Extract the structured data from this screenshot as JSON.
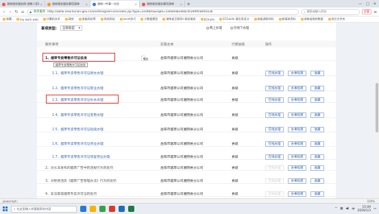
{
  "browser": {
    "tabs": [
      {
        "title": "湖南政务服务网-湖南人民政府",
        "active": false
      },
      {
        "title": "湖南政务服务事项清单",
        "active": false
      },
      {
        "title": "湖南一件事一次办",
        "active": true
      },
      {
        "title": "湖南政务服务事项清单",
        "active": false
      }
    ],
    "new_tab": "+",
    "window_controls": [
      "—",
      "□",
      "✕"
    ],
    "nav": {
      "back": "‹",
      "forward": "›",
      "reload": "↻",
      "home": "⌂"
    },
    "address": {
      "site_label": "政务服务",
      "url_host": "http://zwfw-new.hunan.gov.cn",
      "url_path": "/onething/service/index.jsp?type=xndtbm&orgId=5a9a9dae466c4f399ffc8495036"
    },
    "search_placeholder": "搜索或输入网址",
    "ext_badge": "优惠"
  },
  "bookmarks": [
    "收藏",
    "my work web",
    "计算机技术",
    "政府",
    "各级网站等",
    "其他网站",
    "excel技巧",
    "大数据模型",
    "湖南省互联网+政务服务",
    "ECharts",
    "ECGuide 潇应用设计",
    "各级调研材料",
    "新媒体资料",
    "湖南省政府数据",
    "其它文件夹"
  ],
  "filter": {
    "label": "事项类型:",
    "select_value": "全部类型",
    "radio_online": "网上办理",
    "radio_visit": "仅线下办理"
  },
  "table_header": {
    "col_name": "服务事项",
    "col_org": "实施主体",
    "col_level": "行使层级",
    "col_action": "操作"
  },
  "rows": [
    {
      "name": "1、烟草专卖零售许可证核发",
      "kind": "parent",
      "count_label": "7项",
      "org": "岳阳市烟草公司湘阴县分公司",
      "level": "县级",
      "actions": []
    },
    {
      "name": "1.1、烟草专卖零售许可证新办办理",
      "kind": "child",
      "org": "岳阳市烟草公司湘阴县分公司",
      "level": "县级",
      "actions": [
        "在线办理",
        "办事指南",
        "收藏"
      ]
    },
    {
      "name": "1.2、烟草专卖零售许可证歇业办理",
      "kind": "child",
      "org": "岳阳市烟草公司湘阴县分公司",
      "level": "县级",
      "actions": [
        "在线办理",
        "办事指南",
        "收藏"
      ]
    },
    {
      "name": "1.3、烟草专卖零售许可证补办办理",
      "kind": "child",
      "org": "岳阳市烟草公司湘阴县分公司",
      "level": "县级",
      "actions": [
        "在线办理",
        "办事指南",
        "收藏"
      ]
    },
    {
      "name": "1.4、烟草专卖零售许可证变更办理",
      "kind": "child",
      "org": "岳阳市烟草公司湘阴县分公司",
      "level": "县级",
      "actions": [
        "在线办理",
        "办事指南",
        "收藏"
      ]
    },
    {
      "name": "1.5、烟草专卖零售许可证延续办理",
      "kind": "child",
      "org": "岳阳市烟草公司湘阴县分公司",
      "level": "县级",
      "actions": [
        "在线办理",
        "办事指南",
        "收藏"
      ]
    },
    {
      "name": "1.6、烟草专卖零售许可证停业办理",
      "kind": "child",
      "org": "岳阳市烟草公司湘阴县分公司",
      "level": "县级",
      "actions": [
        "在线办理",
        "办事指南",
        "收藏"
      ]
    },
    {
      "name": "1.7、烟草专卖零售许可证恢复营业办理",
      "kind": "child",
      "org": "岳阳市烟草公司湘阴县分公司",
      "level": "县级",
      "actions": [
        "在线办理",
        "办事指南",
        "收藏"
      ]
    },
    {
      "name": "2、对从非发布的烟草广告中的违规行为的处罚",
      "kind": "other",
      "org": "岳阳市烟草公司湘阴县分公司",
      "level": "县级",
      "actions": [
        "在线办理",
        "办事指南",
        "收藏"
      ],
      "disabled_first": true
    },
    {
      "name": "3、对拒绝违反《烟草广告管理办法》行为的处罚",
      "kind": "other",
      "org": "岳阳市烟草公司湘阴县分公司",
      "level": "县级",
      "actions": [
        "在线办理",
        "办事指南",
        "收藏"
      ],
      "disabled_first": true
    },
    {
      "name": "4、非法取得烟草专卖许可证的处罚",
      "kind": "other",
      "org": "岳阳市烟草公司湘阴县分公司",
      "level": "县级",
      "actions": [
        "在线办理",
        "办事指南",
        "收藏"
      ],
      "disabled_first": true
    }
  ],
  "tooltip": "烟草专卖零售许可证核发",
  "status_bar": {
    "url": "javascript:;",
    "zoom": "100%"
  },
  "taskbar": {
    "search_placeholder": "在这里输入你要搜索的内容",
    "tray_lang": "中",
    "time": "15:09",
    "date": "2020/1/3"
  },
  "colors": {
    "accent_blue": "#2f5ea8",
    "highlight_red": "#e53030",
    "link_blue": "#3a66b0"
  }
}
